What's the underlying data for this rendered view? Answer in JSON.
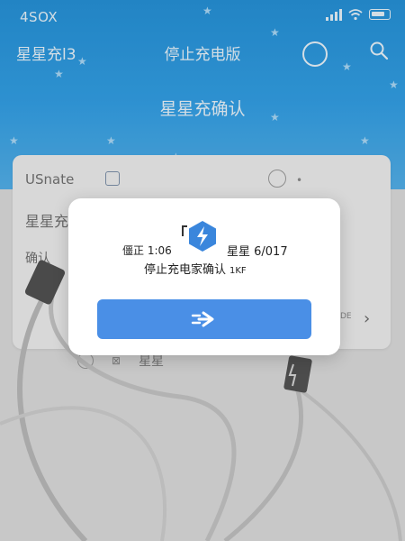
{
  "status_bar": {
    "time": "4SOX"
  },
  "nav": {
    "left_label": "星星充l3",
    "title": "停止充电版"
  },
  "hero": {
    "title": "星星充确认"
  },
  "background_card": {
    "row1_label": "USnate",
    "row2_label": "星星充",
    "row3_label": "确认",
    "small_text": "DE",
    "bottom_text": "星星"
  },
  "modal": {
    "left_text": "僵正 1:06",
    "right_text": "星星 6/017",
    "line2_text": "停止充电家确认",
    "line2_suffix": "1KF",
    "button_label": "⇒"
  },
  "colors": {
    "header_blue": "#2d9ee6",
    "button_blue": "#4a8fe6",
    "hex_icon_blue": "#3a86dc"
  }
}
